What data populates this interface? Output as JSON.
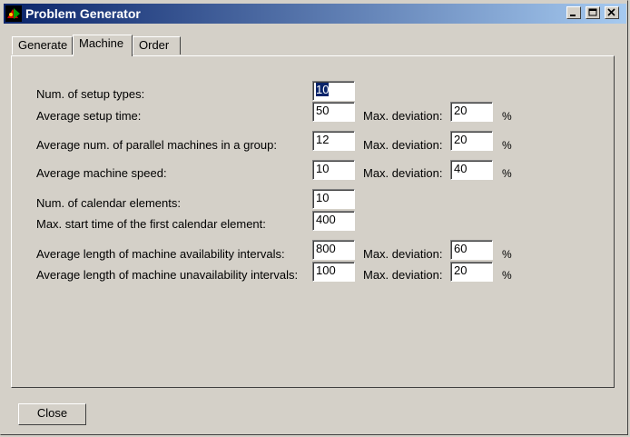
{
  "window": {
    "title": "Problem Generator"
  },
  "tabs": [
    "Generate",
    "Machine",
    "Order"
  ],
  "rows": [
    {
      "label": "Num. of setup types:",
      "value": "10"
    },
    {
      "label": "Average setup time:",
      "value": "50",
      "dev_label": "Max. deviation:",
      "dev_value": "20",
      "unit": "%"
    },
    {
      "label": "Average num. of parallel machines in a group:",
      "value": "12",
      "dev_label": "Max. deviation:",
      "dev_value": "20",
      "unit": "%"
    },
    {
      "label": "Average machine speed:",
      "value": "10",
      "dev_label": "Max. deviation:",
      "dev_value": "40",
      "unit": "%"
    },
    {
      "label": "Num. of calendar elements:",
      "value": "10"
    },
    {
      "label": "Max. start time of the first calendar element:",
      "value": "400"
    },
    {
      "label": "Average length of machine availability intervals:",
      "value": "800",
      "dev_label": "Max. deviation:",
      "dev_value": "60",
      "unit": "%"
    },
    {
      "label": "Average length of machine unavailability intervals:",
      "value": "100",
      "dev_label": "Max. deviation:",
      "dev_value": "20",
      "unit": "%"
    }
  ],
  "buttons": {
    "close": "Close"
  }
}
